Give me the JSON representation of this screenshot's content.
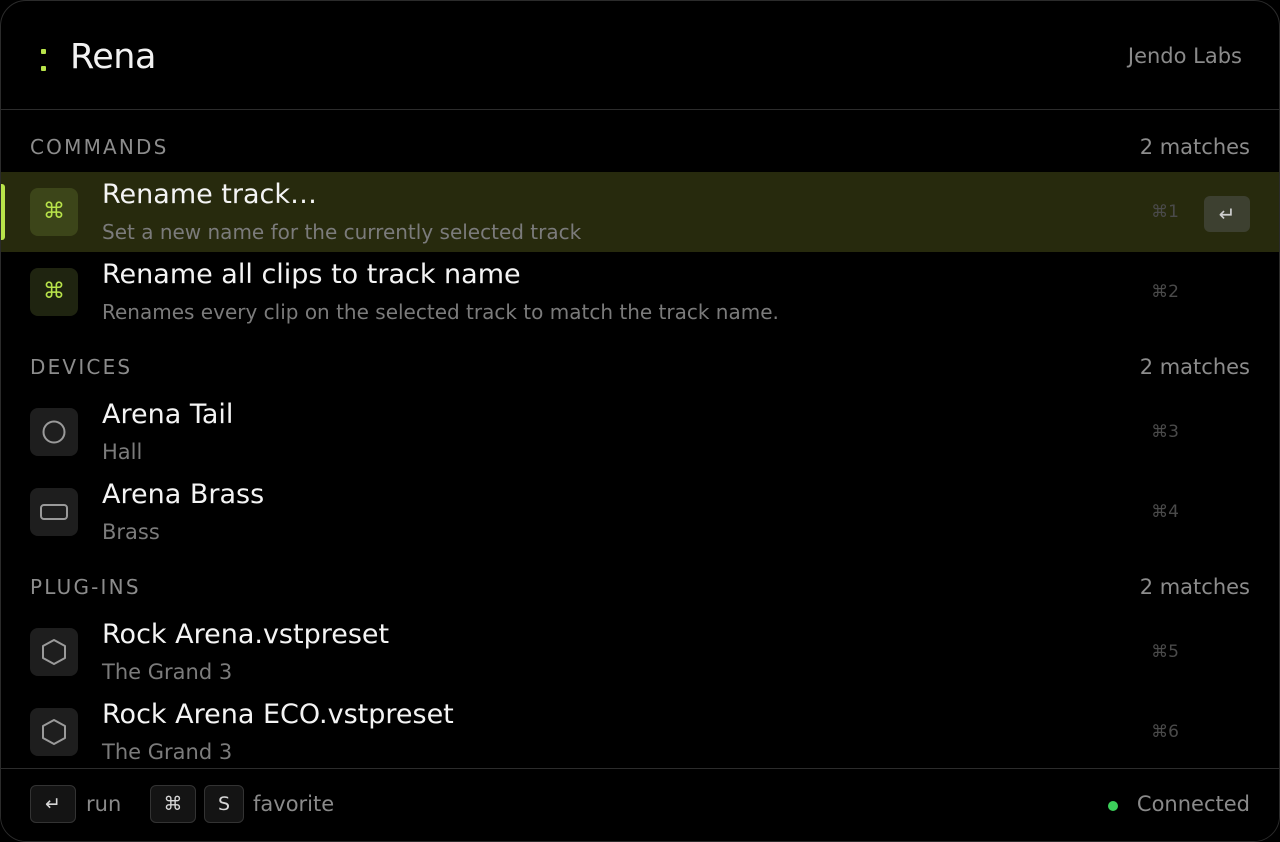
{
  "search": {
    "query": "Rena",
    "brand": "Jendo Labs"
  },
  "sections": [
    {
      "title": "COMMANDS",
      "count": "2 matches",
      "items": [
        {
          "icon": "command-icon",
          "title": "Rename track…",
          "subtitle": "Set a new name for the currently selected track",
          "shortcut": "⌘1",
          "selected": true
        },
        {
          "icon": "command-icon",
          "title": "Rename all clips to track name",
          "subtitle": "Renames every clip on the selected track to match the track name.",
          "shortcut": "⌘2",
          "selected": false
        }
      ]
    },
    {
      "title": "DEVICES",
      "count": "2 matches",
      "items": [
        {
          "icon": "circle-icon",
          "title": "Arena Tail",
          "subtitle": "Hall",
          "shortcut": "⌘3"
        },
        {
          "icon": "rectangle-icon",
          "title": "Arena Brass",
          "subtitle": "Brass",
          "shortcut": "⌘4"
        }
      ]
    },
    {
      "title": "PLUG-INS",
      "count": "2 matches",
      "items": [
        {
          "icon": "hexagon-icon",
          "title": "Rock Arena.vstpreset",
          "subtitle": "The Grand 3",
          "shortcut": "⌘5"
        },
        {
          "icon": "hexagon-icon",
          "title": "Rock Arena ECO.vstpreset",
          "subtitle": "The Grand 3",
          "shortcut": "⌘6"
        }
      ]
    }
  ],
  "selected_action": {
    "enter_glyph": "↵"
  },
  "footer": {
    "run_key": "↵",
    "run_label": "run",
    "cmd_key": "⌘",
    "s_key": "S",
    "favorite_label": "favorite",
    "status": "Connected"
  },
  "colors": {
    "accent": "#b8e34a",
    "selected_bg": "#272a0d",
    "status_ok": "#3ccf5a"
  }
}
